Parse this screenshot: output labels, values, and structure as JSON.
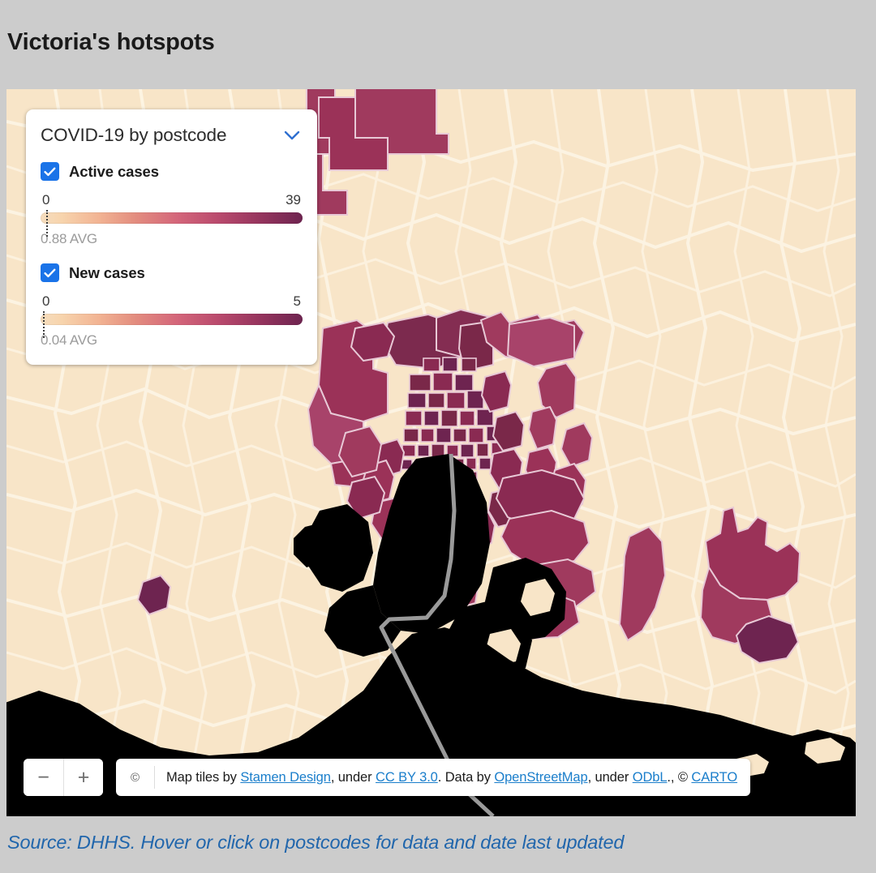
{
  "page": {
    "title": "Victoria's hotspots",
    "background_color": "#cccccc",
    "caption": "Source: DHHS. Hover or click on postcodes for data and date last updated",
    "caption_color": "#2166ac"
  },
  "legend": {
    "title": "COVID-19 by postcode",
    "collapse_icon": "chevron-down-icon",
    "layers": [
      {
        "id": "active-cases",
        "label": "Active cases",
        "checked": true,
        "scale_min": "0",
        "scale_max": "39",
        "avg_label": "0.88 AVG",
        "avg_value": 0.88,
        "avg_percent": 2.3
      },
      {
        "id": "new-cases",
        "label": "New cases",
        "checked": true,
        "scale_min": "0",
        "scale_max": "5",
        "avg_label": "0.04 AVG",
        "avg_value": 0.04,
        "avg_percent": 0.8
      }
    ],
    "gradient_colors": [
      "#f6ddbe",
      "#f2b493",
      "#d4667a",
      "#97355e",
      "#6e2450"
    ]
  },
  "map": {
    "background_color": "#f8e5c8",
    "boundary_color": "#fdf4e4",
    "water_color": "#000000",
    "route_color": "#9a9a9a",
    "hotspot_colors": {
      "light": "#b14a72",
      "mid": "#a03a5e",
      "dark": "#8a2a52",
      "darkest": "#6e2450"
    }
  },
  "zoom_controls": {
    "zoom_out_label": "−",
    "zoom_in_label": "+"
  },
  "attribution": {
    "copyright_symbol": "©",
    "prefix": "Map tiles by ",
    "link_stamen": "Stamen Design",
    "mid1": ", under ",
    "link_ccby": "CC BY 3.0",
    "mid2": ". Data by ",
    "link_osm": "OpenStreetMap",
    "mid3": ", under ",
    "link_odbl": "ODbL",
    "mid4": "., © ",
    "link_carto": "CARTO"
  }
}
